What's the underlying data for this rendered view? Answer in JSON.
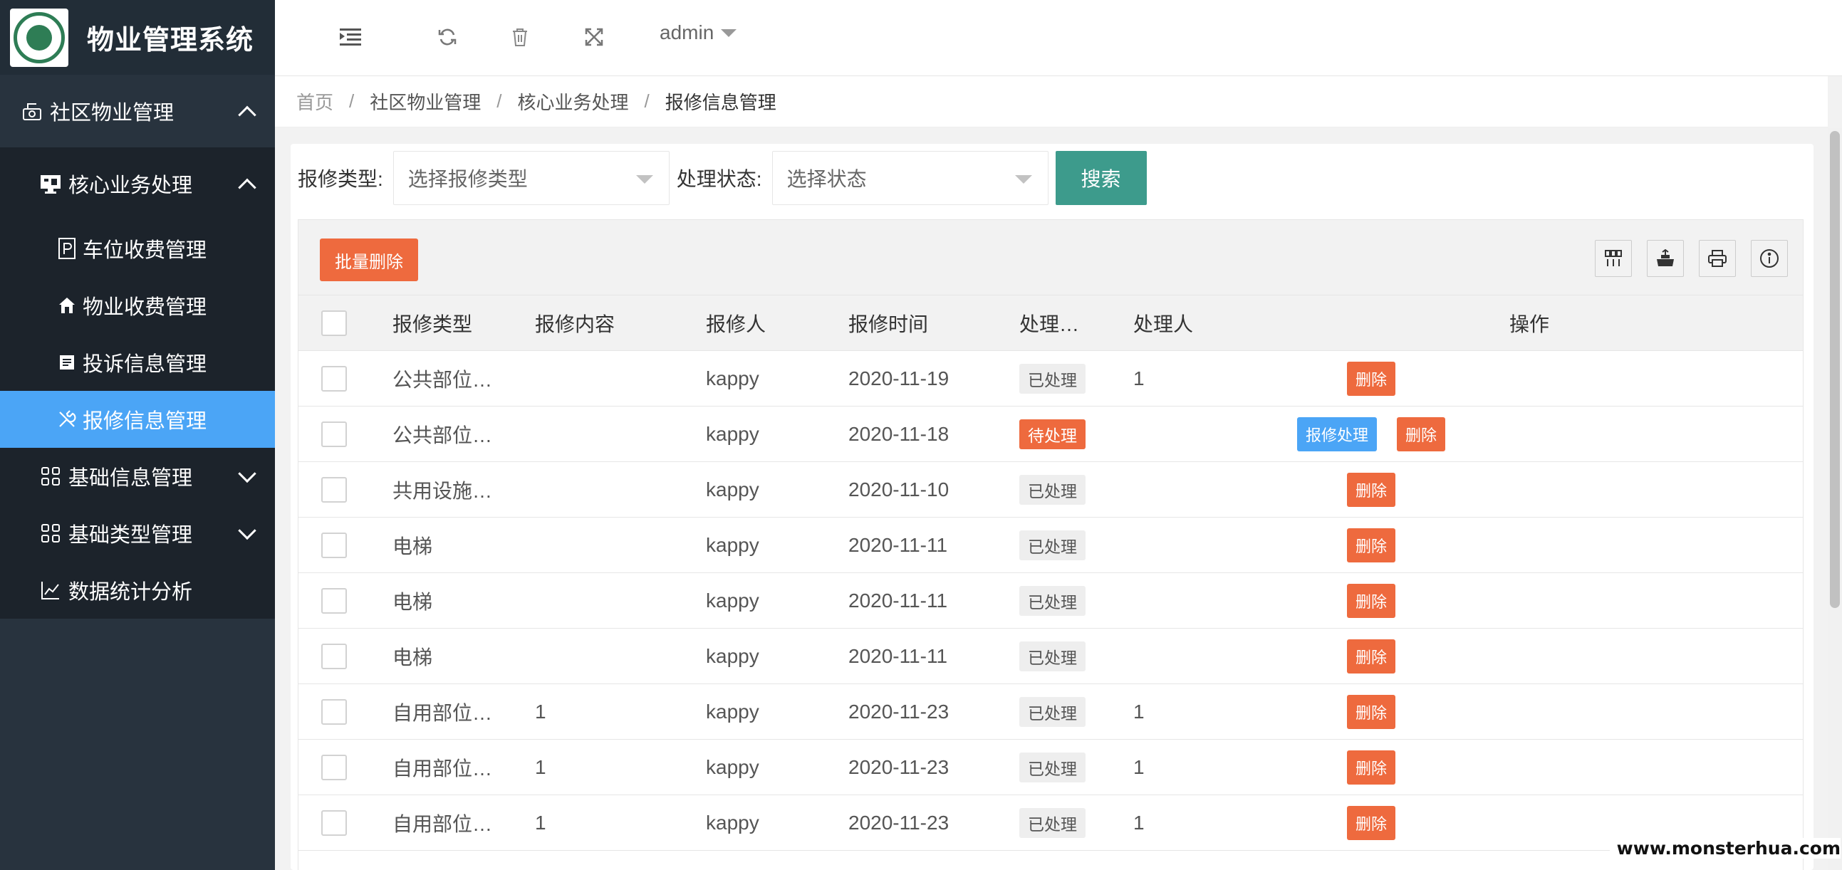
{
  "app": {
    "title": "物业管理系统"
  },
  "header": {
    "user": "admin"
  },
  "sidebar": {
    "group1": {
      "label": "社区物业管理"
    },
    "group1_sub": {
      "label": "核心业务处理"
    },
    "items": [
      {
        "label": "车位收费管理"
      },
      {
        "label": "物业收费管理"
      },
      {
        "label": "投诉信息管理"
      },
      {
        "label": "报修信息管理"
      }
    ],
    "others": [
      {
        "label": "基础信息管理"
      },
      {
        "label": "基础类型管理"
      },
      {
        "label": "数据统计分析"
      }
    ]
  },
  "breadcrumb": [
    "首页",
    "社区物业管理",
    "核心业务处理",
    "报修信息管理"
  ],
  "breadcrumb_sep": "/",
  "search": {
    "type_label": "报修类型:",
    "type_placeholder": "选择报修类型",
    "status_label": "处理状态:",
    "status_placeholder": "选择状态",
    "button": "搜索"
  },
  "toolbar": {
    "batch_delete": "批量删除"
  },
  "table": {
    "headers": [
      "报修类型",
      "报修内容",
      "报修人",
      "报修时间",
      "处理…",
      "处理人",
      "操作"
    ],
    "rows": [
      {
        "type": "公共部位…",
        "content": "",
        "person": "kappy",
        "time": "2020-11-19",
        "status": "已处理",
        "handler": "1"
      },
      {
        "type": "公共部位…",
        "content": "",
        "person": "kappy",
        "time": "2020-11-18",
        "status": "待处理",
        "handler": ""
      },
      {
        "type": "共用设施…",
        "content": "",
        "person": "kappy",
        "time": "2020-11-10",
        "status": "已处理",
        "handler": ""
      },
      {
        "type": "电梯",
        "content": "",
        "person": "kappy",
        "time": "2020-11-11",
        "status": "已处理",
        "handler": ""
      },
      {
        "type": "电梯",
        "content": "",
        "person": "kappy",
        "time": "2020-11-11",
        "status": "已处理",
        "handler": ""
      },
      {
        "type": "电梯",
        "content": "",
        "person": "kappy",
        "time": "2020-11-11",
        "status": "已处理",
        "handler": ""
      },
      {
        "type": "自用部位…",
        "content": "1",
        "person": "kappy",
        "time": "2020-11-23",
        "status": "已处理",
        "handler": "1"
      },
      {
        "type": "自用部位…",
        "content": "1",
        "person": "kappy",
        "time": "2020-11-23",
        "status": "已处理",
        "handler": "1"
      },
      {
        "type": "自用部位…",
        "content": "1",
        "person": "kappy",
        "time": "2020-11-23",
        "status": "已处理",
        "handler": "1"
      }
    ],
    "actions": {
      "process": "报修处理",
      "delete": "删除"
    }
  },
  "watermark": "www.monsterhua.com",
  "colors": {
    "accent": "#4ba5f6",
    "danger": "#ee6a3e",
    "primary": "#3d9b8c",
    "sidebar": "#28333e"
  }
}
